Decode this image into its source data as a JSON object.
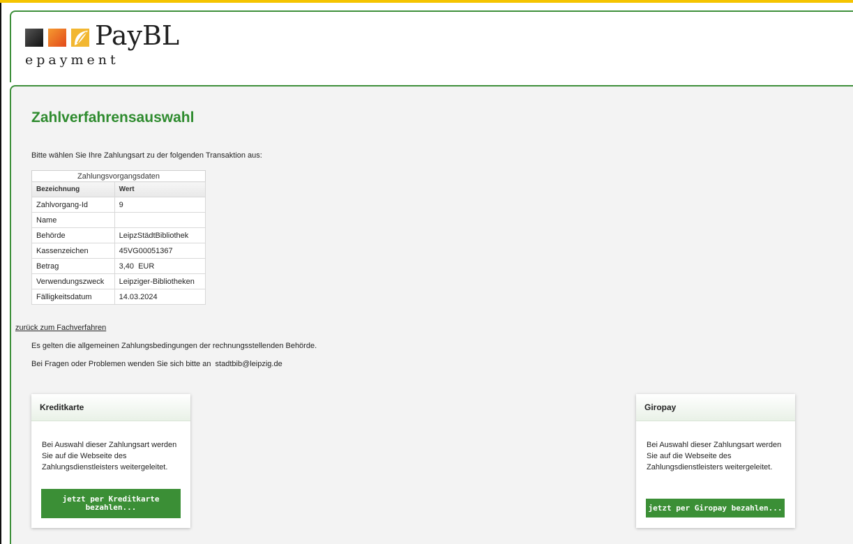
{
  "brand": {
    "name": "PayBL",
    "subtitle": "epayment"
  },
  "page": {
    "title": "Zahlverfahrensauswahl",
    "intro": "Bitte wählen Sie Ihre Zahlungsart zu der folgenden Transaktion aus:"
  },
  "transaction": {
    "caption": "Zahlungsvorgangsdaten",
    "headers": [
      "Bezeichnung",
      "Wert"
    ],
    "rows": [
      [
        "Zahlvorgang-Id",
        "9"
      ],
      [
        "Name",
        ""
      ],
      [
        "Behörde",
        "LeipzStädtBibliothek"
      ],
      [
        "Kassenzeichen",
        "45VG00051367"
      ],
      [
        "Betrag",
        "3,40  EUR"
      ],
      [
        "Verwendungszweck",
        "Leipziger-Bibliotheken"
      ],
      [
        "Fälligkeitsdatum",
        "14.03.2024"
      ]
    ]
  },
  "links": {
    "back": "zurück zum Fachverfahren"
  },
  "info": {
    "terms": "Es gelten die allgemeinen Zahlungsbedingungen der rechnungsstellenden Behörde.",
    "contact": "Bei Fragen oder Problemen wenden Sie sich bitte an  stadtbib@leipzig.de"
  },
  "methods": [
    {
      "title": "Kreditkarte",
      "description": "Bei Auswahl dieser Zahlungsart werden Sie auf die Webseite des Zahlungsdienstleisters weitergeleitet.",
      "button": "jetzt per Kreditkarte bezahlen..."
    },
    {
      "title": "Giropay",
      "description": "Bei Auswahl dieser Zahlungsart werden Sie auf die Webseite des Zahlungsdienstleisters weitergeleitet.",
      "button": "jetzt per Giropay bezahlen..."
    }
  ],
  "colors": {
    "accent_green": "#3b8f36",
    "title_green": "#2e8b2e",
    "top_bar": "#f5c400"
  }
}
